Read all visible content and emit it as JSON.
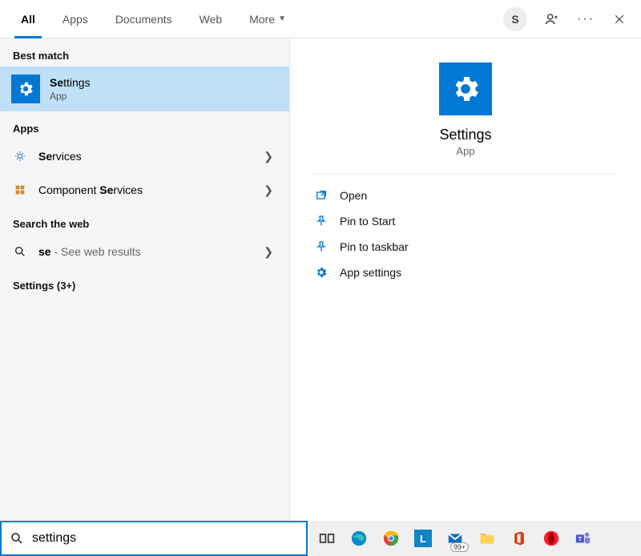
{
  "tabs": {
    "all": "All",
    "apps": "Apps",
    "documents": "Documents",
    "web": "Web",
    "more": "More"
  },
  "avatar_initial": "S",
  "left": {
    "best_match": "Best match",
    "selected_title": "Settings",
    "selected_bold": "Se",
    "selected_sub": "App",
    "apps_label": "Apps",
    "services_bold": "Se",
    "services_rest": "rvices",
    "component_prefix": "Component ",
    "component_bold": "Se",
    "component_rest": "rvices",
    "web_label": "Search the web",
    "web_bold": "se",
    "web_rest": " - See web results",
    "settings_more": "Settings (3+)"
  },
  "right": {
    "title": "Settings",
    "sub": "App",
    "open": "Open",
    "pin_start": "Pin to Start",
    "pin_taskbar": "Pin to taskbar",
    "app_settings": "App settings"
  },
  "search_value": "settings",
  "taskbar_badge": "99+"
}
